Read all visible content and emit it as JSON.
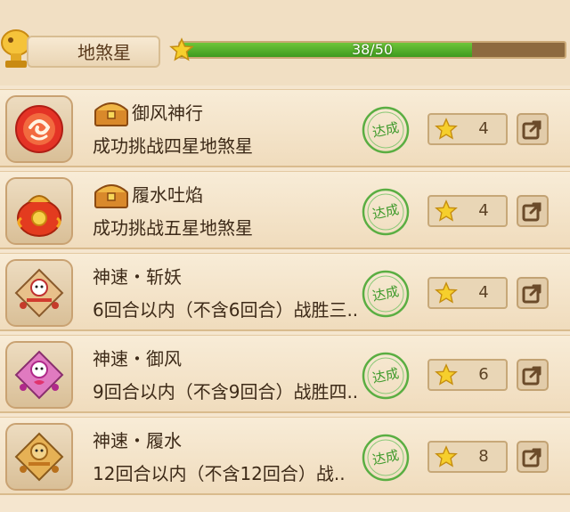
{
  "header": {
    "title": "地煞星",
    "progress_text": "38/50",
    "progress": {
      "current": 38,
      "total": 50
    }
  },
  "colors": {
    "progress_fill": "#4aa82a",
    "stamp_green": "#4ea33a",
    "row_bg": "#f3e3c8",
    "text": "#3d2a18"
  },
  "achievements": [
    {
      "name": "御风神行",
      "description": "成功挑战四星地煞星",
      "status": "达成",
      "reward": "4",
      "has_chest": true,
      "icon": "red-swirl-orb-icon"
    },
    {
      "name": "履水吐焰",
      "description": "成功挑战五星地煞星",
      "status": "达成",
      "reward": "4",
      "has_chest": true,
      "icon": "fire-treasure-bag-icon"
    },
    {
      "name": "神速・斩妖",
      "description": "6回合以内（不含6回合）战胜三..",
      "status": "达成",
      "reward": "4",
      "has_chest": false,
      "icon": "kite-warrior-icon"
    },
    {
      "name": "神速・御风",
      "description": "9回合以内（不含9回合）战胜四..",
      "status": "达成",
      "reward": "6",
      "has_chest": false,
      "icon": "pink-kite-warrior-icon"
    },
    {
      "name": "神速・履水",
      "description": "12回合以内（不含12回合）战..",
      "status": "达成",
      "reward": "8",
      "has_chest": false,
      "icon": "gold-kite-warrior-icon"
    }
  ]
}
